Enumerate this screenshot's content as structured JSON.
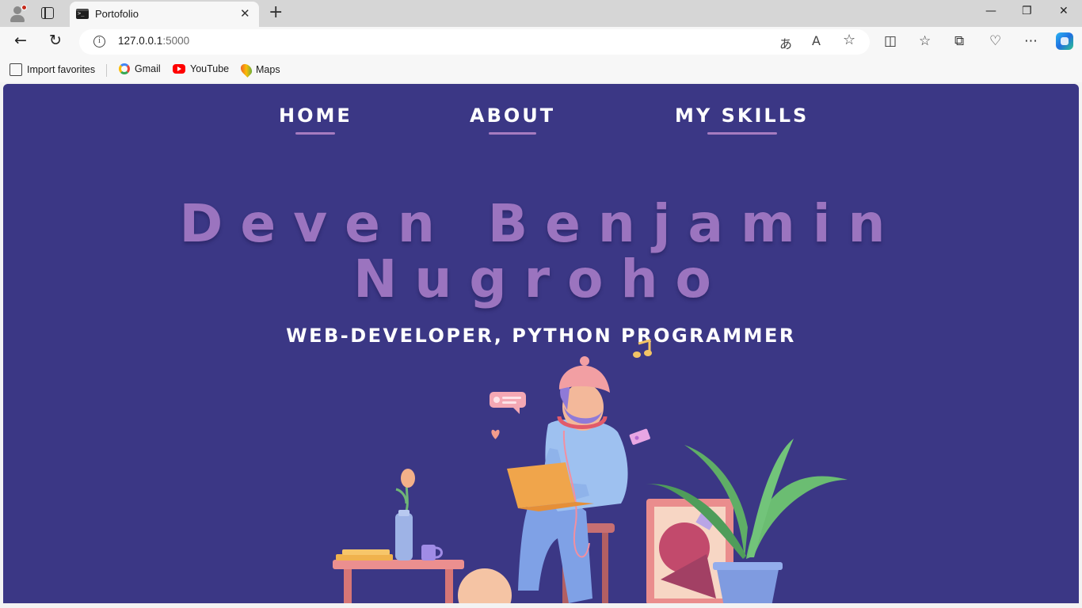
{
  "browser": {
    "tab_title": "Portofolio",
    "url_host": "127.0.0.1",
    "url_port": ":5000",
    "favorites": [
      {
        "label": "Import favorites",
        "icon": "import-icon"
      },
      {
        "label": "Gmail",
        "icon": "google-icon"
      },
      {
        "label": "YouTube",
        "icon": "youtube-icon"
      },
      {
        "label": "Maps",
        "icon": "maps-icon"
      }
    ]
  },
  "page": {
    "nav": [
      {
        "label": "HOME"
      },
      {
        "label": "ABOUT"
      },
      {
        "label": "MY SKILLS"
      }
    ],
    "name_line1": "Deven Benjamin",
    "name_line2": "Nugroho",
    "role": "WEB-DEVELOPER, PYTHON PROGRAMMER",
    "colors": {
      "background": "#3b3785",
      "name": "#9b74bf",
      "nav_underline": "#a77cc0",
      "text": "#ffffff"
    }
  }
}
